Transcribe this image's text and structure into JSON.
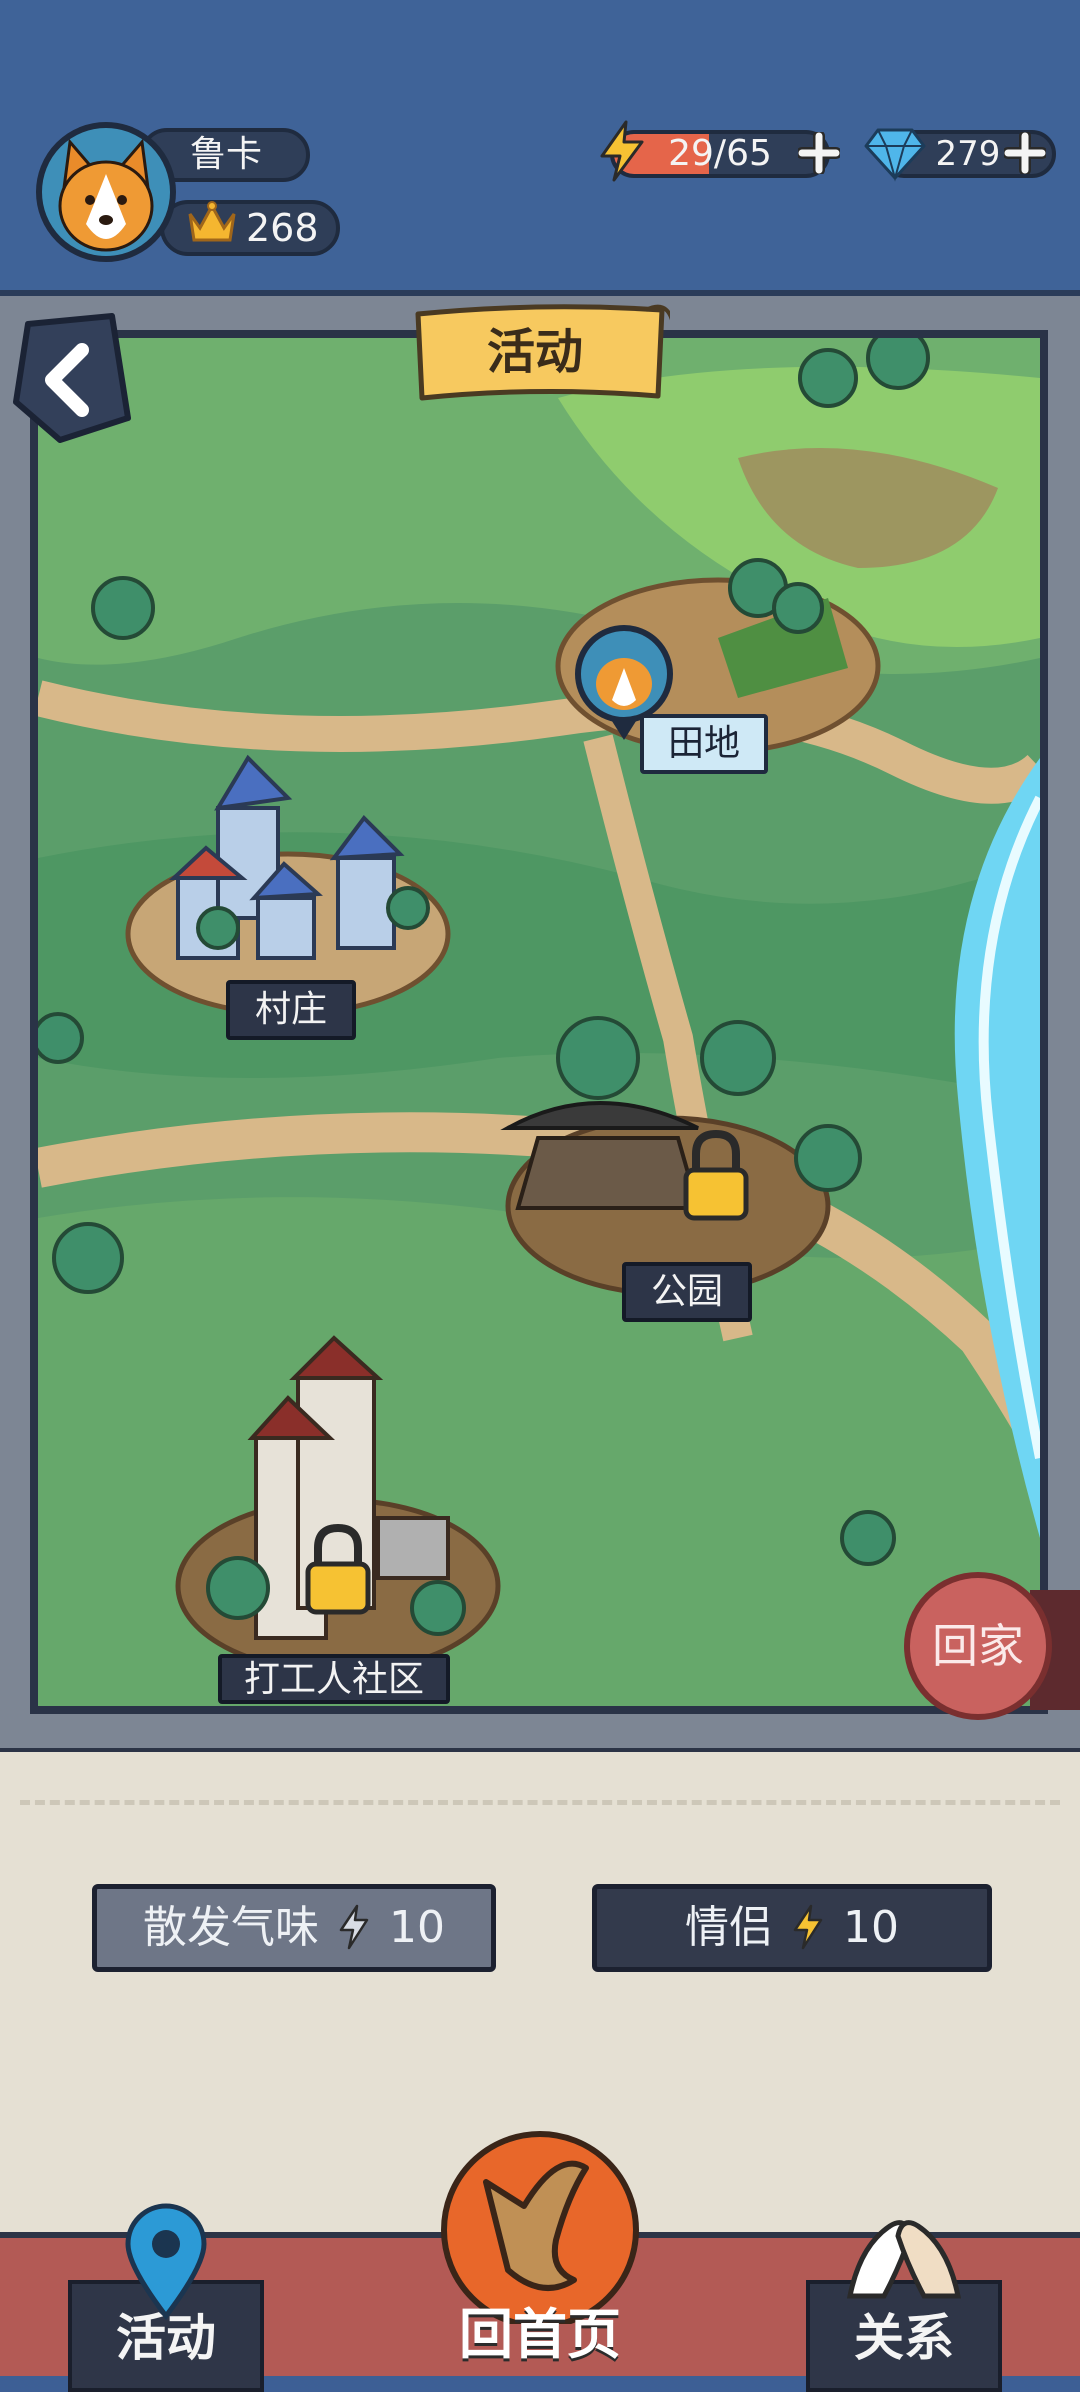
{
  "profile": {
    "name": "鲁卡",
    "crowns": "268"
  },
  "resources": {
    "energy": "29/65",
    "energy_fraction": 0.446,
    "gems": "279"
  },
  "map": {
    "title": "活动",
    "places": [
      {
        "name": "田地",
        "locked": false,
        "current": true
      },
      {
        "name": "村庄",
        "locked": false,
        "current": false
      },
      {
        "name": "公园",
        "locked": true,
        "current": false
      },
      {
        "name": "打工人社区",
        "locked": true,
        "current": false
      }
    ],
    "home_button": "回家"
  },
  "actions": [
    {
      "label": "散发气味",
      "cost": "10"
    },
    {
      "label": "情侣",
      "cost": "10"
    }
  ],
  "nav": {
    "left": "活动",
    "center": "回首页",
    "right": "关系"
  },
  "colors": {
    "header": "#3f6398",
    "energy_fill": "#e5654a",
    "action_gray": "#6e7687",
    "action_dark": "#333a4c",
    "home_button": "#c9625f"
  }
}
